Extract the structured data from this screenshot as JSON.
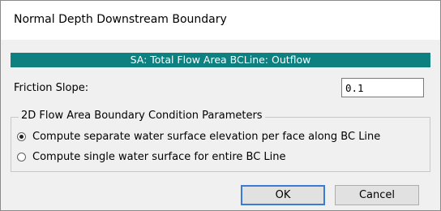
{
  "window": {
    "title": "Normal Depth Downstream Boundary"
  },
  "banner": {
    "text": "SA: Total Flow Area BCLine: Outflow"
  },
  "friction": {
    "label": "Friction Slope:",
    "value": "0.1"
  },
  "group": {
    "legend": "2D Flow Area Boundary Condition Parameters",
    "options": [
      {
        "label": "Compute separate water surface elevation per face along BC Line",
        "selected": true
      },
      {
        "label": "Compute single water surface for entire BC Line",
        "selected": false
      }
    ]
  },
  "buttons": {
    "ok": "OK",
    "cancel": "Cancel"
  },
  "colors": {
    "banner_bg": "#0f8080",
    "banner_text": "#ffffff"
  }
}
